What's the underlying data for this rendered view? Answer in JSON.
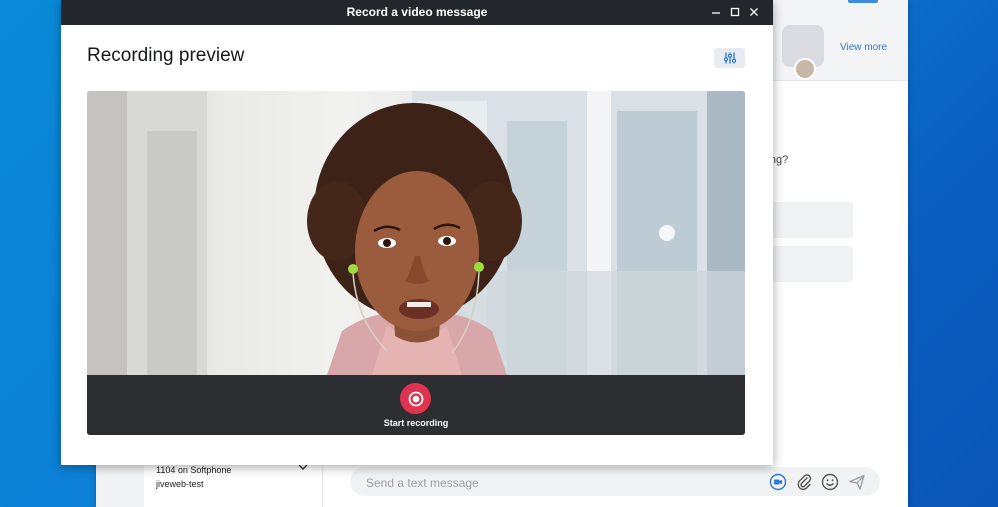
{
  "background_app": {
    "view_more_label": "View more",
    "question_text": "neeting?",
    "phone_label": "1104 on Softphone",
    "phone_sub": "jiveweb-test",
    "composer_placeholder": "Send a text message",
    "icons": [
      "video-icon",
      "attachment-icon",
      "emoji-icon",
      "send-icon"
    ]
  },
  "modal": {
    "window_title": "Record a video message",
    "heading": "Recording preview",
    "record_label": "Start recording",
    "window_controls": [
      "minimize-icon",
      "maximize-icon",
      "close-icon"
    ],
    "accent_color": "#e0334f",
    "titlebar_color": "#23272c"
  }
}
